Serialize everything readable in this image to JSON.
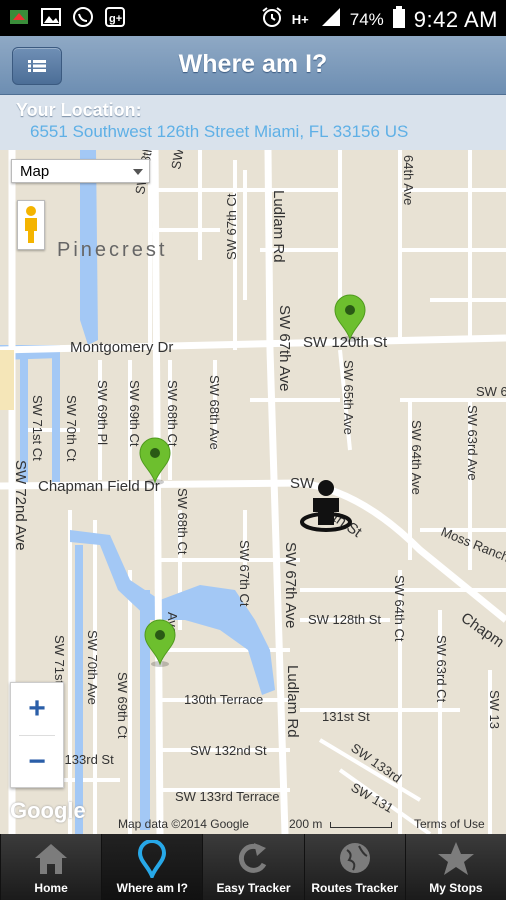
{
  "status_bar": {
    "left_icons": [
      "app-icon",
      "gallery-icon",
      "whatsapp-icon",
      "google-plus-icon"
    ],
    "right_icons": [
      "alarm-icon",
      "signal-hplus-icon",
      "signal-bars-icon",
      "battery-icon"
    ],
    "network": "H+",
    "battery": "74%",
    "time": "9:42 AM"
  },
  "header": {
    "title": "Where am I?",
    "menu_icon": "list-icon"
  },
  "location": {
    "label": "Your Location:",
    "address": "6551 Southwest 126th Street Miami, FL 33156 US"
  },
  "map": {
    "type_selector": "Map",
    "labels": {
      "pinecrest": "Pinecrest",
      "montgomery": "Montgomery Dr",
      "sw120": "SW 120th St",
      "chapman": "Chapman Field Dr",
      "ludlam_top": "Ludlam Rd",
      "ludlam_bottom": "Ludlam Rd",
      "sw67ave_mid": "SW 67th Ave",
      "sw67ave_top": "SW 67th Ave",
      "sw72": "SW 72nd Ave",
      "sw71ct": "SW 71st Ct",
      "sw71ave": "SW 71st Ave",
      "sw70ct": "SW 70th Ct",
      "sw70ave": "SW 70th Ave",
      "sw69pl": "SW 69th Pl",
      "sw69ct": "SW 69th Ct",
      "sw69ct2": "SW 69th Ct",
      "sw68ct": "SW 68th Ct",
      "sw68ct2": "SW 68th Ct",
      "sw68ct3": "SW 68th Ct",
      "sw68ave": "SW 68th Ave",
      "sw68ave_top": "SW 68th Ave",
      "sw67ct": "SW 67th Ct",
      "sw67ct2": "SW 67th Ct",
      "sw65ave": "SW 65th Ave",
      "sw64ave": "SW 64th Ave",
      "sw64ct": "SW 64th Ct",
      "sw63ave": "SW 63rd Ave",
      "sw63ct": "SW 63rd Ct",
      "sw128": "SW 128th St",
      "sw131": "131st St",
      "sw132": "SW 132nd St",
      "sw133": "SW 133rd Terrace",
      "sw133st": "SW 133rd St",
      "sw133rd": "SW 133rd",
      "sw131b": "SW 131",
      "terr130": "130th Terrace",
      "sw13": "SW 13",
      "moss": "Moss Ranch",
      "chapman_right": "Chapm",
      "th_st": "th St",
      "ave_frag": "Ave",
      "ave64_top": "64th Ave",
      "sw": "SW",
      "sw6": "SW 6",
      "sw68dr": "SW 68th Ct"
    },
    "attribution": {
      "google": "Google",
      "data": "Map data ©2014 Google",
      "scale": "200 m",
      "terms": "Terms of Use"
    },
    "zoom_in": "+",
    "zoom_out": "−",
    "marker_color": "#6dbf2e",
    "water_color": "#a3c8f5",
    "road_color": "#ffffff"
  },
  "tabs": [
    {
      "label": "Home",
      "icon": "home-icon"
    },
    {
      "label": "Where am I?",
      "icon": "location-pin-icon"
    },
    {
      "label": "Easy Tracker",
      "icon": "refresh-icon"
    },
    {
      "label": "Routes Tracker",
      "icon": "globe-icon"
    },
    {
      "label": "My Stops",
      "icon": "star-icon"
    }
  ]
}
